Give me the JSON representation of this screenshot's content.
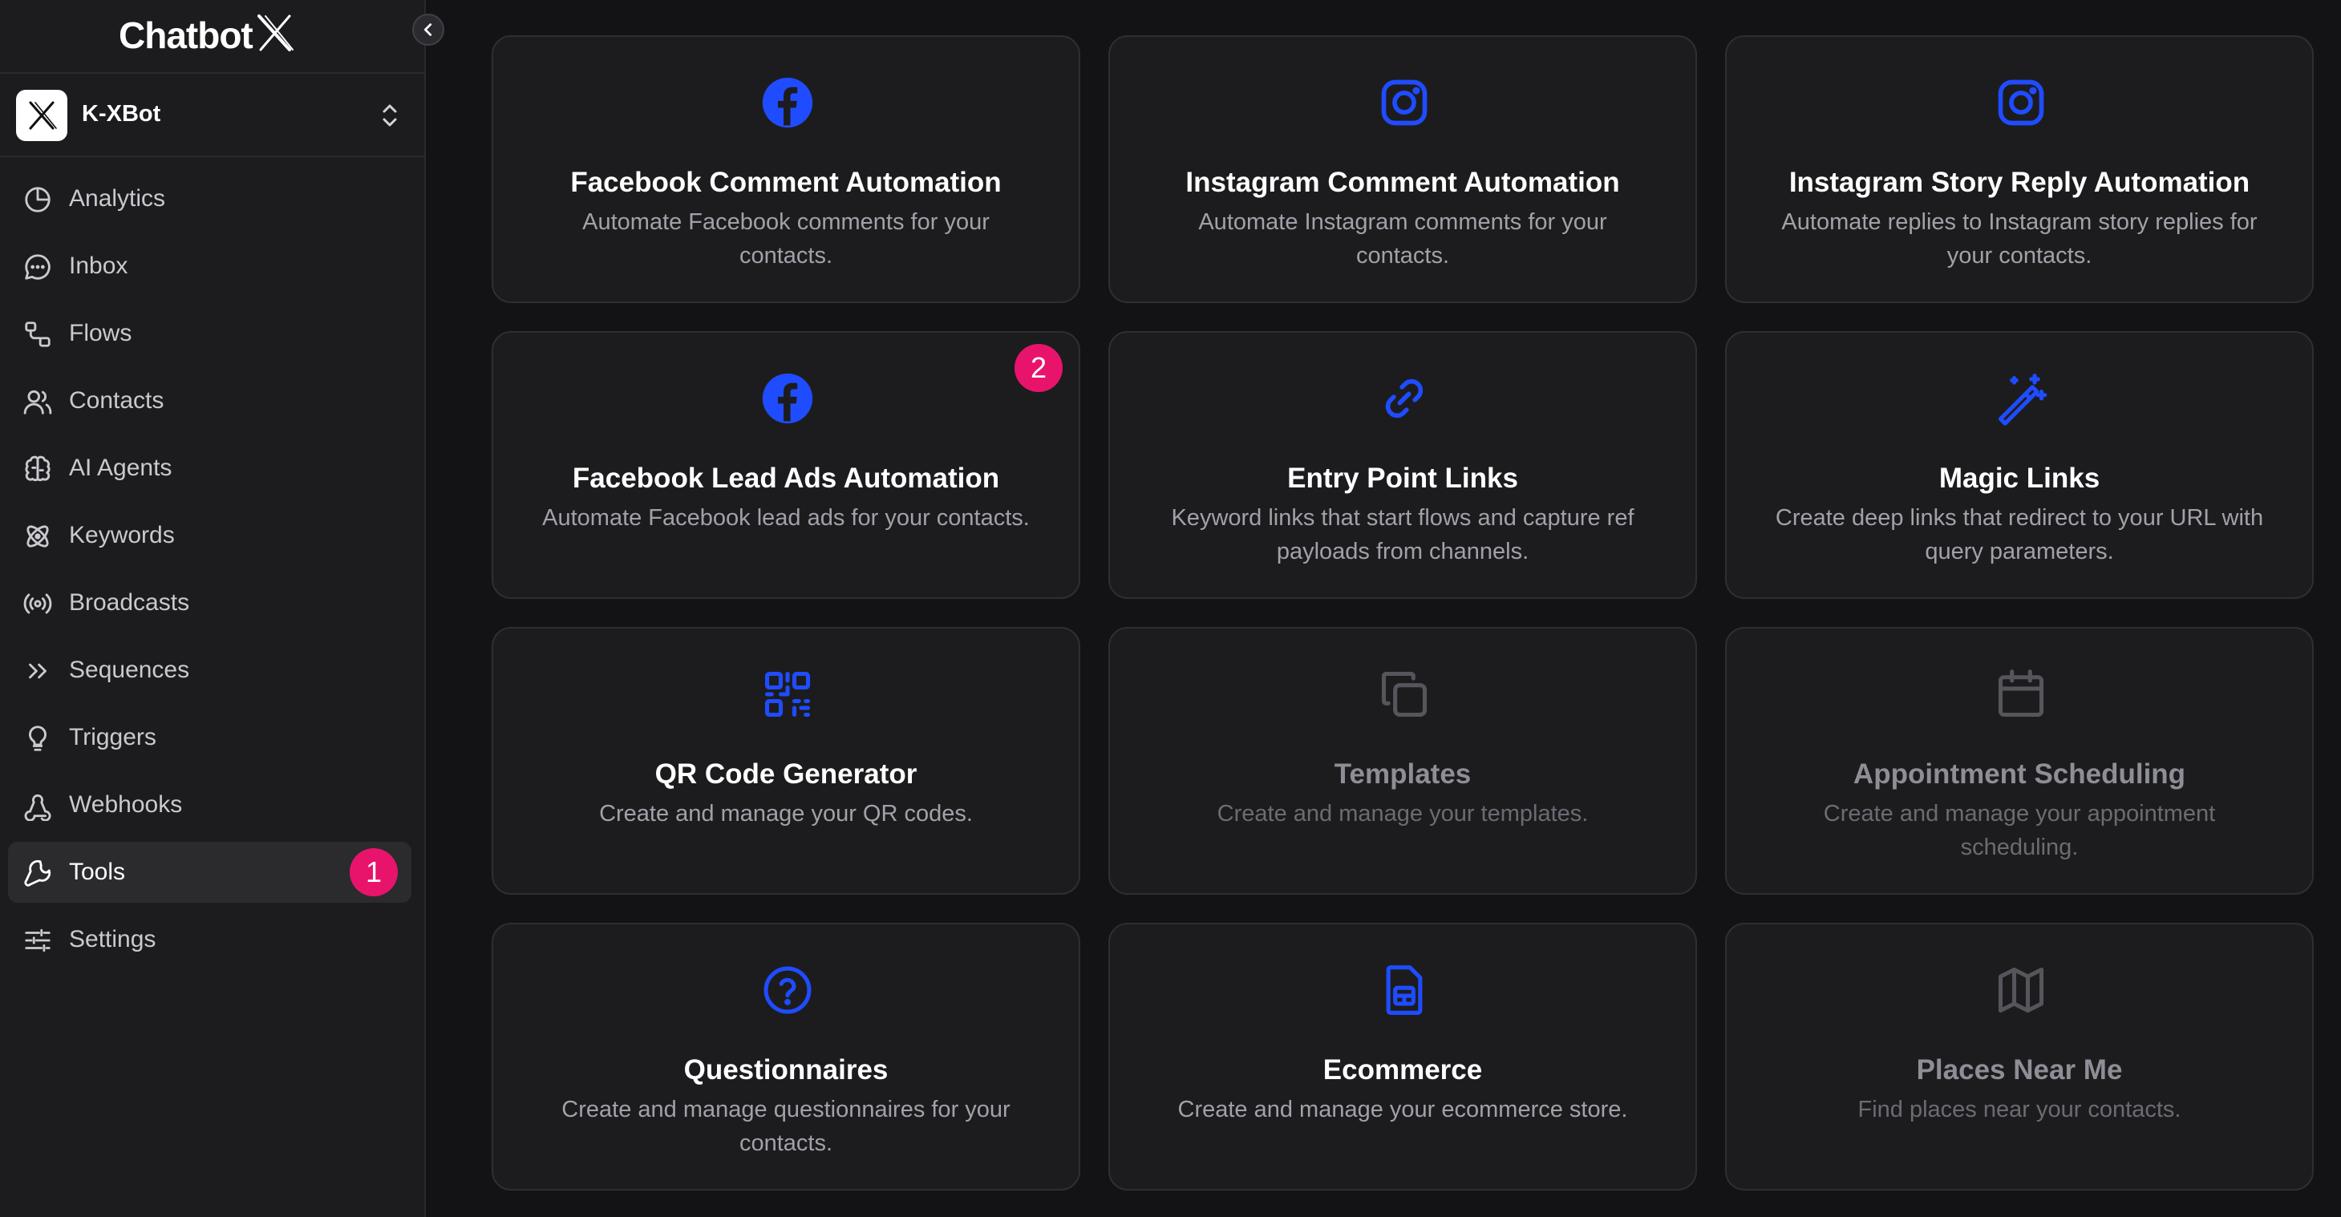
{
  "brand": {
    "name": "Chatbot",
    "name_suffix": "X"
  },
  "workspace": {
    "name": "K-XBot"
  },
  "sidebar": {
    "items": [
      {
        "label": "Analytics",
        "icon": "pie-chart-icon"
      },
      {
        "label": "Inbox",
        "icon": "chat-bubble-icon"
      },
      {
        "label": "Flows",
        "icon": "flow-icon"
      },
      {
        "label": "Contacts",
        "icon": "users-icon"
      },
      {
        "label": "AI Agents",
        "icon": "brain-icon"
      },
      {
        "label": "Keywords",
        "icon": "atom-icon"
      },
      {
        "label": "Broadcasts",
        "icon": "broadcast-icon"
      },
      {
        "label": "Sequences",
        "icon": "double-chevron-right-icon"
      },
      {
        "label": "Triggers",
        "icon": "lightbulb-icon"
      },
      {
        "label": "Webhooks",
        "icon": "webhook-icon"
      },
      {
        "label": "Tools",
        "icon": "wrench-icon",
        "active": true,
        "badge": "1"
      },
      {
        "label": "Settings",
        "icon": "sliders-icon"
      }
    ]
  },
  "tools": [
    {
      "title": "Facebook Comment Automation",
      "description": "Automate Facebook comments for your contacts.",
      "icon": "facebook-icon",
      "enabled": true
    },
    {
      "title": "Instagram Comment Automation",
      "description": "Automate Instagram comments for your contacts.",
      "icon": "instagram-icon",
      "enabled": true
    },
    {
      "title": "Instagram Story Reply Automation",
      "description": "Automate replies to Instagram story replies for your contacts.",
      "icon": "instagram-icon",
      "enabled": true
    },
    {
      "title": "Facebook Lead Ads Automation",
      "description": "Automate Facebook lead ads for your contacts.",
      "icon": "facebook-icon",
      "enabled": true,
      "badge": "2"
    },
    {
      "title": "Entry Point Links",
      "description": "Keyword links that start flows and capture ref payloads from channels.",
      "icon": "link-icon",
      "enabled": true
    },
    {
      "title": "Magic Links",
      "description": "Create deep links that redirect to your URL with query parameters.",
      "icon": "magic-wand-icon",
      "enabled": true
    },
    {
      "title": "QR Code Generator",
      "description": "Create and manage your QR codes.",
      "icon": "qr-code-icon",
      "enabled": true
    },
    {
      "title": "Templates",
      "description": "Create and manage your templates.",
      "icon": "copy-icon",
      "enabled": false
    },
    {
      "title": "Appointment Scheduling",
      "description": "Create and manage your appointment scheduling.",
      "icon": "calendar-icon",
      "enabled": false
    },
    {
      "title": "Questionnaires",
      "description": "Create and manage questionnaires for your contacts.",
      "icon": "question-circle-icon",
      "enabled": true
    },
    {
      "title": "Ecommerce",
      "description": "Create and manage your ecommerce store.",
      "icon": "store-icon",
      "enabled": true
    },
    {
      "title": "Places Near Me",
      "description": "Find places near your contacts.",
      "icon": "map-icon",
      "enabled": false
    }
  ],
  "colors": {
    "accent": "#1f4cff",
    "badge": "#e8146b",
    "background": "#131316",
    "card": "#1c1c1e"
  }
}
